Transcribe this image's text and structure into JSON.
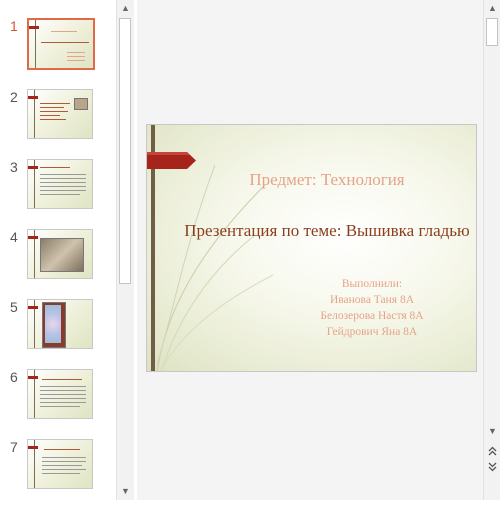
{
  "thumbnails": [
    {
      "number": "1"
    },
    {
      "number": "2"
    },
    {
      "number": "3"
    },
    {
      "number": "4"
    },
    {
      "number": "5"
    },
    {
      "number": "6"
    },
    {
      "number": "7"
    }
  ],
  "selected_slide": "1",
  "slide": {
    "subject_title": "Предмет: Технология",
    "main_title": "Презентация по теме: Вышивка гладью",
    "authors": [
      "Выполнили:",
      "Иванова Таня 8А",
      "Белозерова Настя 8А",
      "Гейдрович Яна 8А"
    ]
  },
  "icons": {
    "scroll_up": "triangle-up-icon",
    "scroll_down": "triangle-down-icon",
    "prev_slide": "double-chevron-up-icon",
    "next_slide": "double-chevron-down-icon"
  },
  "colors": {
    "accent": "#d35230",
    "title_light": "#e5a489",
    "title_dark": "#8a3f1e",
    "ribbon_red": "#a6241a"
  }
}
